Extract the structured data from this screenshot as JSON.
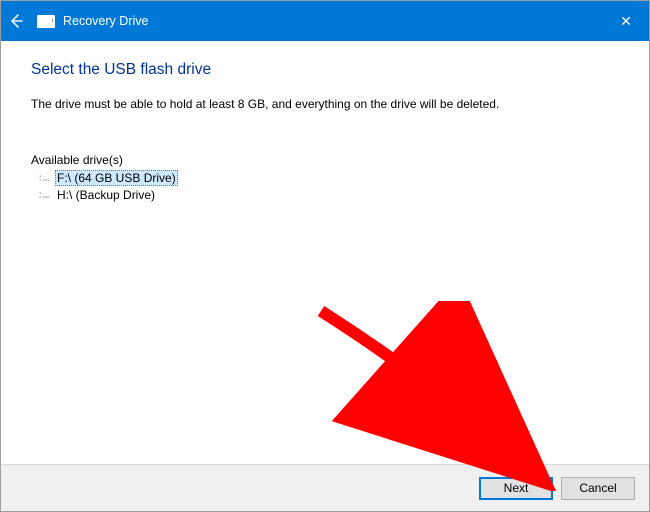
{
  "titlebar": {
    "title": "Recovery Drive",
    "close_glyph": "✕"
  },
  "heading": "Select the USB flash drive",
  "instruction": "The drive must be able to hold at least 8 GB, and everything on the drive will be deleted.",
  "drives": {
    "label": "Available drive(s)",
    "items": [
      {
        "label": "F:\\ (64 GB USB Drive)",
        "selected": true
      },
      {
        "label": "H:\\ (Backup Drive)",
        "selected": false
      }
    ]
  },
  "buttons": {
    "next": "Next",
    "cancel": "Cancel"
  },
  "colors": {
    "accent": "#0078d7",
    "heading": "#003399"
  }
}
